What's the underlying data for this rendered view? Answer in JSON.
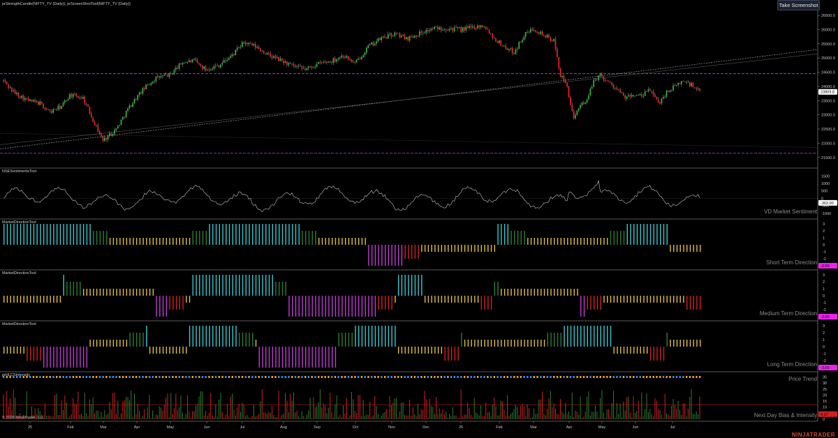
{
  "app": {
    "screenshot_button": "Take Screenshot",
    "copyright": "© 2025 NinjaTrader, LLC",
    "brand": "NINJATRADER"
  },
  "panels": {
    "price_header": "prStrengthCandle(NIFTY_TV (Daily)), prScreenShotTool(NIFTY_TV (Daily))",
    "sentiment_header": "NSESentimentsTool",
    "short_header": "MarketDirectionTool",
    "medium_header": "MarketDirectionTool",
    "long_header": "MarketDirectionTool",
    "trend_header": "prHLCSIntensity",
    "sentiment_label": "VD Market Sentiment",
    "short_label": "Short Term Direction",
    "medium_label": "Medium Term Direction",
    "long_label": "Long Term Direction",
    "trend_label": "Price Trend",
    "bias_label": "Next Day Bias & Intensity"
  },
  "price_axis": {
    "ticks": [
      "26500.0",
      "26000.0",
      "25500.0",
      "25000.0",
      "24500.0",
      "24000.0",
      "23500.0",
      "23000.0",
      "22500.0",
      "22000.0",
      "21500.0"
    ],
    "current": "23809.8",
    "ylim": [
      21200,
      26700
    ]
  },
  "sentiment_axis": {
    "ticks": [
      "1500",
      "1000",
      "500",
      "0",
      "-500",
      "-1000"
    ],
    "current": "-302.00"
  },
  "direction_axis": {
    "ticks": [
      "3",
      "2",
      "1",
      "0",
      "-1",
      "-2",
      "-3"
    ]
  },
  "direction_values": {
    "short": "-3.00",
    "medium": "-3.00",
    "long": "-3.00"
  },
  "trend_axis": {
    "ticks": [
      "35",
      "30",
      "25",
      "20",
      "15",
      "10",
      "5",
      "0"
    ],
    "current": "4.17"
  },
  "time_axis": [
    "25",
    "Feb",
    "Mar",
    "Apr",
    "May",
    "Jun",
    "Jul",
    "Aug",
    "Sep",
    "Oct",
    "Nov",
    "Dec",
    "26",
    "Feb",
    "Mar",
    "Apr",
    "May",
    "Jun",
    "Jul"
  ],
  "colors": {
    "up": "#2fbf3a",
    "down": "#ff2020",
    "magenta": "#c23bd6",
    "cyan": "#38c8d0",
    "green": "#2e7d32",
    "yellow": "#e0c040",
    "red": "#d22020",
    "orange": "#f0a030",
    "blue": "#3a8fe8",
    "purple": "#8b3fd0",
    "current_badge": "#ee22ee"
  },
  "chart_data": {
    "type": "candlestick",
    "series": [
      {
        "name": "NIFTY_TV (Daily)",
        "anchors": [
          [
            0,
            24200
          ],
          [
            6,
            23800
          ],
          [
            15,
            23500
          ],
          [
            22,
            23400
          ],
          [
            28,
            23100
          ],
          [
            35,
            23300
          ],
          [
            40,
            23700
          ],
          [
            48,
            23600
          ],
          [
            55,
            22700
          ],
          [
            60,
            22100
          ],
          [
            68,
            22500
          ],
          [
            75,
            23200
          ],
          [
            80,
            23600
          ],
          [
            86,
            24000
          ],
          [
            92,
            24300
          ],
          [
            100,
            24400
          ],
          [
            108,
            24850
          ],
          [
            115,
            24900
          ],
          [
            122,
            24600
          ],
          [
            130,
            24750
          ],
          [
            138,
            25100
          ],
          [
            145,
            25550
          ],
          [
            152,
            25400
          ],
          [
            160,
            25100
          ],
          [
            168,
            24900
          ],
          [
            175,
            24700
          ],
          [
            182,
            24600
          ],
          [
            190,
            24800
          ],
          [
            198,
            24900
          ],
          [
            205,
            25100
          ],
          [
            212,
            24800
          ],
          [
            220,
            25400
          ],
          [
            228,
            25700
          ],
          [
            236,
            25850
          ],
          [
            244,
            25700
          ],
          [
            252,
            25900
          ],
          [
            260,
            26050
          ],
          [
            268,
            26050
          ],
          [
            276,
            26000
          ],
          [
            284,
            26100
          ],
          [
            290,
            26150
          ],
          [
            296,
            25700
          ],
          [
            302,
            25400
          ],
          [
            308,
            25200
          ],
          [
            314,
            25800
          ],
          [
            320,
            26050
          ],
          [
            326,
            25800
          ],
          [
            332,
            25600
          ],
          [
            336,
            24400
          ],
          [
            340,
            24000
          ],
          [
            344,
            22800
          ],
          [
            348,
            23400
          ],
          [
            352,
            23500
          ],
          [
            356,
            24200
          ],
          [
            360,
            24400
          ],
          [
            365,
            24150
          ],
          [
            370,
            23900
          ],
          [
            375,
            23600
          ],
          [
            380,
            23700
          ],
          [
            385,
            23650
          ],
          [
            390,
            23900
          ],
          [
            395,
            23400
          ],
          [
            400,
            23800
          ],
          [
            405,
            24000
          ],
          [
            410,
            24200
          ],
          [
            415,
            24050
          ],
          [
            420,
            23800
          ]
        ]
      }
    ]
  }
}
